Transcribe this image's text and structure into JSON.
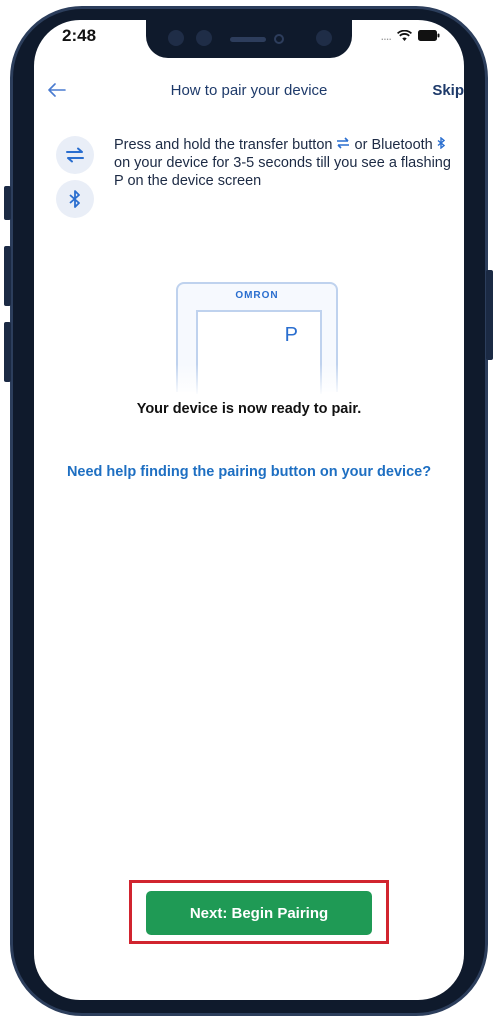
{
  "status_bar": {
    "time": "2:48",
    "signal_text": "....",
    "icons": [
      "wifi-icon",
      "battery-icon"
    ]
  },
  "nav": {
    "back_icon": "arrow-left-icon",
    "title": "How to pair your device",
    "skip_label": "Skip"
  },
  "instruction": {
    "icons": [
      "transfer-icon",
      "bluetooth-icon"
    ],
    "text_part1": "Press and hold the transfer button",
    "text_part2": "or",
    "text_part3": "Bluetooth",
    "text_part4": "on your device for 3-5 seconds till you see a flashing P on the device screen"
  },
  "device_illustration": {
    "brand": "OMRON",
    "display_char": "P"
  },
  "ready_text": "Your device is now ready to pair.",
  "help_link": "Need help finding the pairing button on your device?",
  "primary_button": {
    "label": "Next: Begin Pairing"
  },
  "colors": {
    "accent_blue": "#1e6fc2",
    "button_green": "#1f9a55",
    "highlight_red": "#d1242f",
    "frame": "#0f1a2c"
  }
}
